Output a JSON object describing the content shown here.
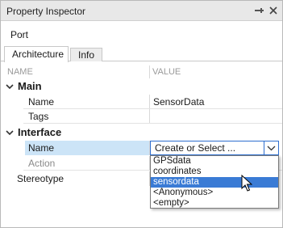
{
  "window": {
    "title": "Property Inspector"
  },
  "subject": "Port",
  "tabs": [
    {
      "label": "Architecture"
    },
    {
      "label": "Info"
    }
  ],
  "columns": {
    "name": "NAME",
    "value": "VALUE"
  },
  "groups": [
    {
      "label": "Main",
      "rows": [
        {
          "label": "Name",
          "value": "SensorData"
        },
        {
          "label": "Tags",
          "value": ""
        }
      ]
    },
    {
      "label": "Interface",
      "rows": [
        {
          "label": "Name",
          "value": ""
        },
        {
          "label": "Action",
          "value": ""
        }
      ]
    }
  ],
  "stereotype": {
    "label": "Stereotype",
    "value": ""
  },
  "combo": {
    "value": "Create or Select ..."
  },
  "dropdown": {
    "options": [
      "GPSdata",
      "coordinates",
      "sensordata",
      "<Anonymous>",
      "<empty>"
    ],
    "selected_index": 2
  },
  "colors": {
    "selection": "#3a7bd5",
    "row_highlight": "#cce4f7",
    "focus_border": "#2f6fcf"
  },
  "icons": {
    "pin": "pin-icon",
    "close": "close-icon",
    "expand": "chevron-down-icon",
    "combo": "chevron-down-icon",
    "cursor": "mouse-pointer-icon"
  }
}
